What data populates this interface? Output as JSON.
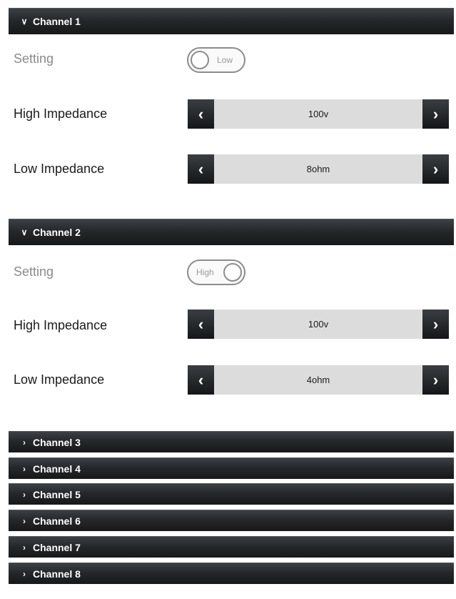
{
  "channels_open": [
    {
      "title": "Channel 1",
      "setting_label": "Setting",
      "setting_value": "Low",
      "high_label": "High Impedance",
      "high_value": "100v",
      "low_label": "Low Impedance",
      "low_value": "8ohm"
    },
    {
      "title": "Channel 2",
      "setting_label": "Setting",
      "setting_value": "High",
      "high_label": "High Impedance",
      "high_value": "100v",
      "low_label": "Low Impedance",
      "low_value": "4ohm"
    }
  ],
  "channels_closed": [
    "Channel 3",
    "Channel 4",
    "Channel 5",
    "Channel 6",
    "Channel 7",
    "Channel 8"
  ],
  "icons": {
    "expanded": "chevron-down-icon",
    "collapsed": "chevron-right-icon",
    "prev": "chevron-left-icon",
    "next": "chevron-right-icon"
  },
  "colors": {
    "header_dark": "#161819",
    "stepper_bg": "#dcdcdc",
    "muted_text": "#8a8a8a"
  }
}
